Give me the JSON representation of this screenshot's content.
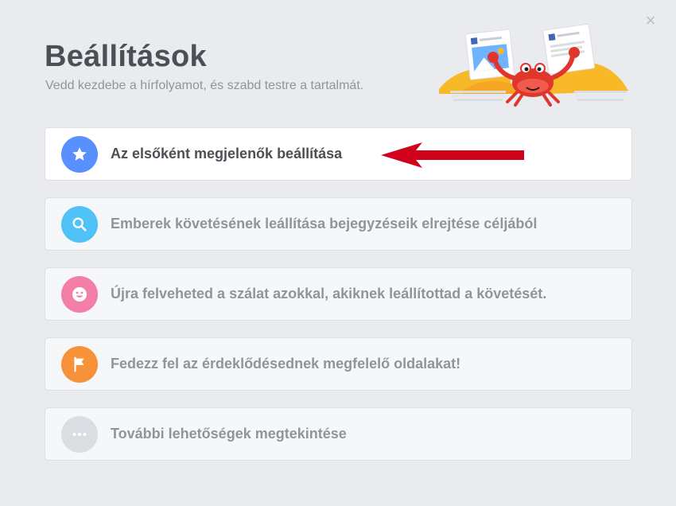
{
  "dialog": {
    "title": "Beállítások",
    "subtitle": "Vedd kezdebe a hírfolyamot, és szabd testre a tartalmát.",
    "close_label": "×"
  },
  "options": [
    {
      "label": "Az elsőként megjelenők beállítása",
      "icon": "star-icon",
      "color": "#5890ff",
      "active": true
    },
    {
      "label": "Emberek követésének leállítása bejegyzéseik elrejtése céljából",
      "icon": "search-icon",
      "color": "#4fc3f7"
    },
    {
      "label": "Újra felveheted a szálat azokkal, akiknek leállítottad a követését.",
      "icon": "smiley-icon",
      "color": "#f37fa8"
    },
    {
      "label": "Fedezz fel az érdeklődésednek megfelelő oldalakat!",
      "icon": "flag-icon",
      "color": "#f7923b"
    },
    {
      "label": "További lehetőségek megtekintése",
      "icon": "more-icon",
      "color": "#dadde1"
    }
  ],
  "colors": {
    "background": "#e9ebee",
    "arrow": "#d0021b"
  }
}
